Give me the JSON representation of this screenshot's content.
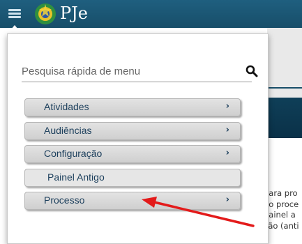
{
  "header": {
    "logo_text": "PJe"
  },
  "search": {
    "placeholder": "Pesquisa rápida de menu"
  },
  "menu": {
    "items": [
      {
        "label": "Atividades",
        "submenu": true
      },
      {
        "label": "Audiências",
        "submenu": true
      },
      {
        "label": "Configuração",
        "submenu": true
      },
      {
        "label": "Painel Antigo",
        "submenu": false
      },
      {
        "label": "Processo",
        "submenu": true
      }
    ]
  },
  "background_text": {
    "lines": [
      "para pro",
      "do proce",
      "painel a",
      "ção (anti"
    ]
  },
  "colors": {
    "topbar": "#1f5f7f",
    "menu_item_text": "#1c3f5c",
    "annotation_arrow": "#e31a1a",
    "logo_accent": "#e06a1a"
  },
  "icons": [
    "hamburger-menu-icon",
    "coat-of-arms-icon",
    "search-icon",
    "chevron-right-icon"
  ]
}
